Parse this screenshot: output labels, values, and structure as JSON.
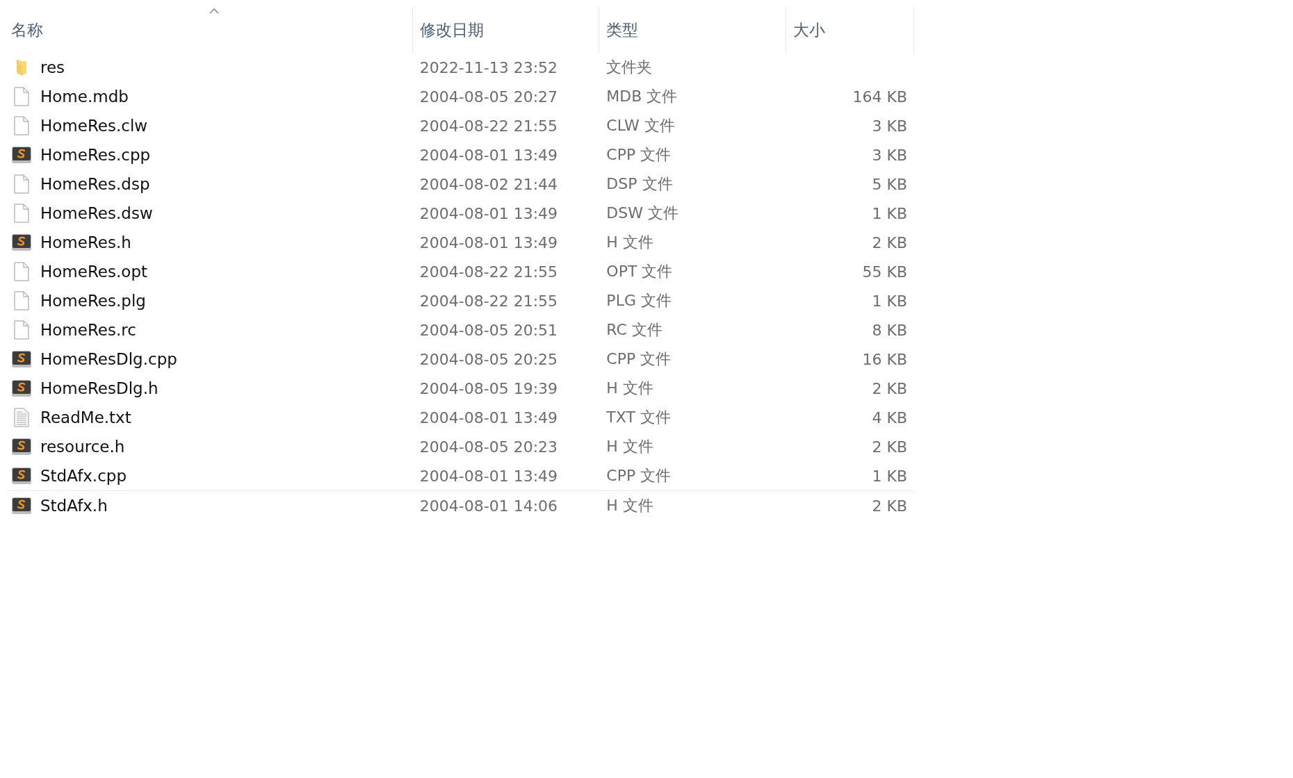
{
  "columns": [
    {
      "label": "名称",
      "sorted": true
    },
    {
      "label": "修改日期",
      "sorted": false
    },
    {
      "label": "类型",
      "sorted": false
    },
    {
      "label": "大小",
      "sorted": false
    }
  ],
  "files": [
    {
      "name": "res",
      "modified": "2022-11-13 23:52",
      "type": "文件夹",
      "kind": "folder",
      "focused": false
    },
    {
      "name": "Home.mdb",
      "modified": "2004-08-05 20:27",
      "type": "MDB 文件",
      "size": "164 KB",
      "kind": "blank",
      "focused": false
    },
    {
      "name": "HomeRes.clw",
      "modified": "2004-08-22 21:55",
      "type": "CLW 文件",
      "size": "3 KB",
      "kind": "blank",
      "focused": false
    },
    {
      "name": "HomeRes.cpp",
      "modified": "2004-08-01 13:49",
      "type": "CPP 文件",
      "size": "3 KB",
      "kind": "code",
      "focused": false
    },
    {
      "name": "HomeRes.dsp",
      "modified": "2004-08-02 21:44",
      "type": "DSP 文件",
      "size": "5 KB",
      "kind": "blank",
      "focused": false
    },
    {
      "name": "HomeRes.dsw",
      "modified": "2004-08-01 13:49",
      "type": "DSW 文件",
      "size": "1 KB",
      "kind": "blank",
      "focused": false
    },
    {
      "name": "HomeRes.h",
      "modified": "2004-08-01 13:49",
      "type": "H 文件",
      "size": "2 KB",
      "kind": "code",
      "focused": false
    },
    {
      "name": "HomeRes.opt",
      "modified": "2004-08-22 21:55",
      "type": "OPT 文件",
      "size": "55 KB",
      "kind": "blank",
      "focused": false
    },
    {
      "name": "HomeRes.plg",
      "modified": "2004-08-22 21:55",
      "type": "PLG 文件",
      "size": "1 KB",
      "kind": "blank",
      "focused": false
    },
    {
      "name": "HomeRes.rc",
      "modified": "2004-08-05 20:51",
      "type": "RC 文件",
      "size": "8 KB",
      "kind": "blank",
      "focused": false
    },
    {
      "name": "HomeResDlg.cpp",
      "modified": "2004-08-05 20:25",
      "type": "CPP 文件",
      "size": "16 KB",
      "kind": "code",
      "focused": false
    },
    {
      "name": "HomeResDlg.h",
      "modified": "2004-08-05 19:39",
      "type": "H 文件",
      "size": "2 KB",
      "kind": "code",
      "focused": false
    },
    {
      "name": "ReadMe.txt",
      "modified": "2004-08-01 13:49",
      "type": "TXT 文件",
      "size": "4 KB",
      "kind": "text",
      "focused": false
    },
    {
      "name": "resource.h",
      "modified": "2004-08-05 20:23",
      "type": "H 文件",
      "size": "2 KB",
      "kind": "code",
      "focused": false
    },
    {
      "name": "StdAfx.cpp",
      "modified": "2004-08-01 13:49",
      "type": "CPP 文件",
      "size": "1 KB",
      "kind": "code",
      "focused": false
    },
    {
      "name": "StdAfx.h",
      "modified": "2004-08-01 14:06",
      "type": "H 文件",
      "size": "2 KB",
      "kind": "code",
      "focused": true
    }
  ]
}
